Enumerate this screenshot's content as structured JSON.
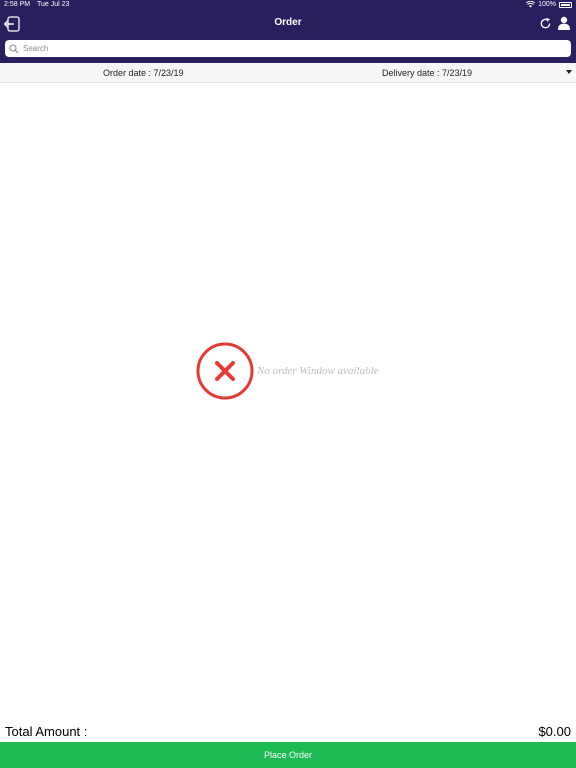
{
  "status_bar": {
    "time": "2:58 PM",
    "date": "Tue Jul 23",
    "battery": "100%"
  },
  "header": {
    "title": "Order"
  },
  "search": {
    "placeholder": "Search"
  },
  "dates": {
    "order_label": "Order date : ",
    "order_value": "7/23/19",
    "delivery_label": "Delivery date : ",
    "delivery_value": "7/23/19"
  },
  "empty_state": {
    "message": "No order Window available"
  },
  "footer": {
    "total_label": "Total Amount :",
    "total_value": "$0.00",
    "place_order_label": "Place Order"
  },
  "colors": {
    "header_bg": "#2a1f5e",
    "place_order_bg": "#1db954",
    "error_red": "#e53935"
  }
}
